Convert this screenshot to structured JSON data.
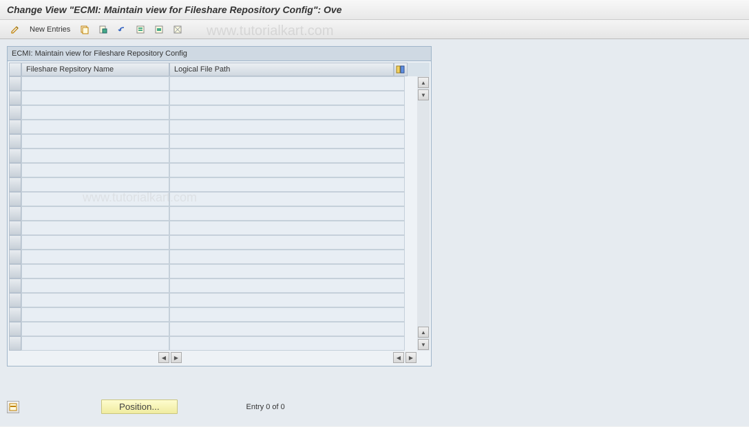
{
  "title": "Change View \"ECMI: Maintain view for Fileshare Repository Config\": Ove",
  "watermark": "www.tutorialkart.com",
  "toolbar": {
    "new_entries": "New Entries"
  },
  "panel": {
    "header": "ECMI: Maintain view for Fileshare Repository Config",
    "columns": {
      "fileshare": "Fileshare Repsitory Name",
      "logical": "Logical File Path"
    }
  },
  "footer": {
    "position_label": "Position...",
    "entry_text": "Entry 0 of 0"
  }
}
